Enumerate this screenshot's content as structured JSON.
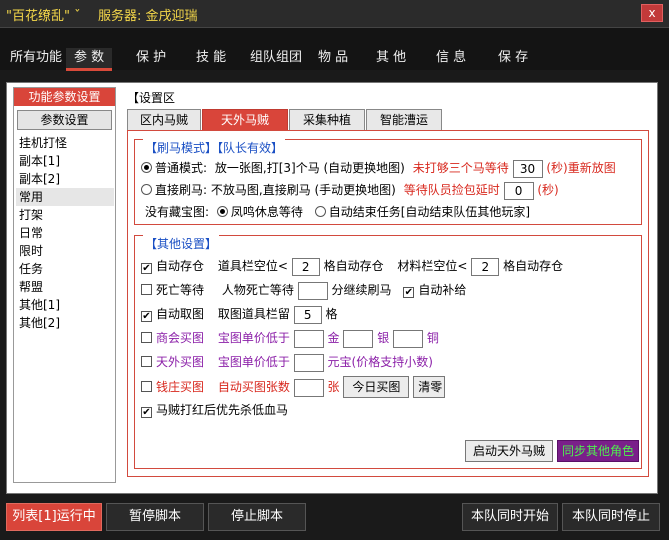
{
  "window": {
    "title": "\"百花缭乱\"",
    "title_suffix": "ˇ",
    "server": "服务器: 金戌迎瑞",
    "close_label": "x"
  },
  "menu": [
    "所有功能",
    "参 数",
    "保 护",
    "技 能",
    "组队组团",
    "物 品",
    "其 他",
    "信 息",
    "保 存"
  ],
  "left": {
    "title": "功能参数设置",
    "button": "参数设置",
    "items": [
      "挂机打怪",
      "副本[1]",
      "副本[2]",
      "常用",
      "打架",
      "日常",
      "限时",
      "任务",
      "帮盟",
      "其他[1]",
      "其他[2]"
    ],
    "selected": "常用"
  },
  "setting_area": "【设置区",
  "tabs": [
    "区内马贼",
    "天外马贼",
    "采集种植",
    "智能漕运"
  ],
  "active_tab": "天外马贼",
  "mode": {
    "title": "【刷马模式】【队长有效】",
    "normal_label": "普通模式:",
    "normal_desc": "放一张图,打[3]个马 (自动更换地图)",
    "normal_extra": "未打够三个马等待",
    "normal_value": "30",
    "normal_unit": "(秒)重新放图",
    "direct_label": "直接刷马:",
    "direct_desc": "不放马图,直接刷马 (手动更换地图)",
    "direct_extra": "等待队员捡包延时",
    "direct_value": "0",
    "direct_unit": "(秒)",
    "no_map_label": "没有藏宝图:",
    "opt1": "凤鸣休息等待",
    "opt2": "自动结束任务[自动结束队伍其他玩家]"
  },
  "other": {
    "title": "【其他设置】",
    "auto_store": "自动存仓",
    "bag_free_label": "道具栏空位<",
    "bag_free_value": "2",
    "bag_free_suffix": "格自动存仓",
    "mat_free_label": "材料栏空位<",
    "mat_free_value": "2",
    "mat_free_suffix": "格自动存仓",
    "death_wait": "死亡等待",
    "death_label": "人物死亡等待",
    "death_value": "",
    "death_suffix": "分继续刷马",
    "auto_supply": "自动补给",
    "auto_map": "自动取图",
    "map_label": "取图道具栏留",
    "map_value": "5",
    "map_suffix": "格",
    "shop_buy": "商会买图",
    "shop_price_label": "宝图单价低于",
    "gold": "金",
    "silver": "银",
    "copper": "铜",
    "sky_buy": "天外买图",
    "sky_price_label": "宝图单价低于",
    "yuanbao": "元宝(价格支持小数)",
    "bank_buy": "钱庄买图",
    "bank_count_label": "自动买图张数",
    "zhang": "张",
    "today_btn": "今日买图",
    "clear_btn": "清零",
    "red_first": "马贼打红后优先杀低血马",
    "start_btn": "启动天外马贼",
    "sync_btn": "同步其他角色"
  },
  "bottom": [
    "列表[1]运行中",
    "暂停脚本",
    "停止脚本",
    "本队同时开始",
    "本队同时停止"
  ]
}
